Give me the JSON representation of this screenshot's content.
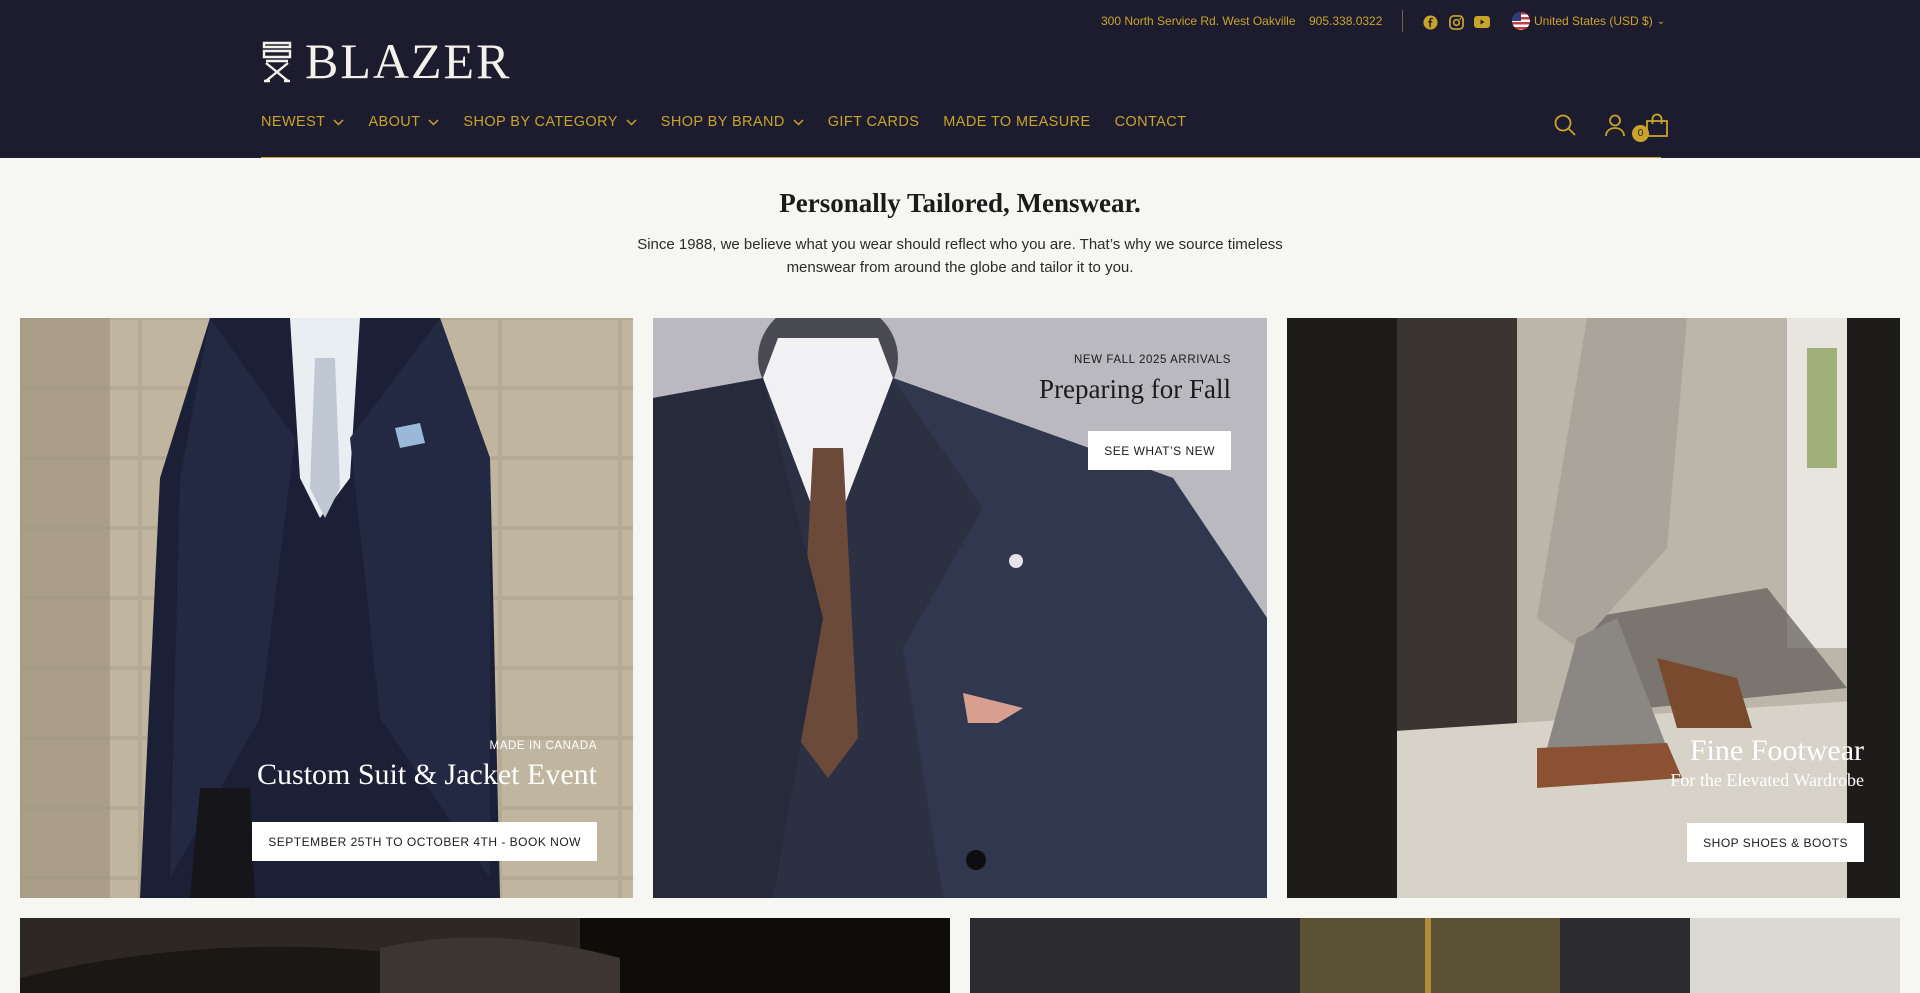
{
  "utility": {
    "address": "300 North Service Rd. West Oakville",
    "phone": "905.338.0322",
    "social": [
      "facebook-icon",
      "instagram-icon",
      "youtube-icon"
    ],
    "country": "United States (USD $)"
  },
  "brand": {
    "name": "BLAZER"
  },
  "nav": {
    "items": [
      {
        "label": "NEWEST",
        "dropdown": true
      },
      {
        "label": "ABOUT",
        "dropdown": true
      },
      {
        "label": "SHOP BY CATEGORY",
        "dropdown": true
      },
      {
        "label": "SHOP BY BRAND",
        "dropdown": true
      },
      {
        "label": "GIFT CARDS",
        "dropdown": false
      },
      {
        "label": "MADE TO MEASURE",
        "dropdown": false
      },
      {
        "label": "CONTACT",
        "dropdown": false
      }
    ]
  },
  "header_icons": {
    "cart_count": "0"
  },
  "intro": {
    "title": "Personally Tailored, Menswear.",
    "text": "Since 1988, we believe what you wear should reflect who you are. That’s why we source timeless menswear from around the globe and tailor it to you."
  },
  "panels": {
    "suit": {
      "eyebrow": "MADE IN CANADA",
      "title": "Custom Suit & Jacket Event",
      "cta": "SEPTEMBER 25TH TO OCTOBER 4TH - BOOK NOW"
    },
    "fall": {
      "eyebrow": "NEW FALL 2025 ARRIVALS",
      "title": "Preparing for Fall",
      "cta": "SEE WHAT’S NEW"
    },
    "footwear": {
      "title": "Fine Footwear",
      "subtitle": "For the Elevated Wardrobe",
      "cta": "SHOP SHOES & BOOTS"
    }
  },
  "colors": {
    "header_bg": "#1d1c2f",
    "accent_gold": "#c9a42a",
    "page_bg": "#f6f6f2"
  }
}
